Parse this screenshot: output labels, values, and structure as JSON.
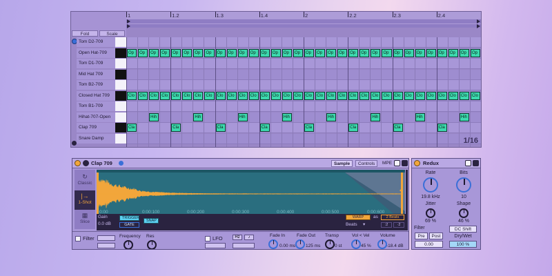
{
  "midi_editor": {
    "ruler": [
      "1",
      "1.2",
      "1.3",
      "1.4",
      "2",
      "2.2",
      "2.3",
      "2.4"
    ],
    "fold_label": "Fold",
    "scale_label": "Scale",
    "zoom": "1/16",
    "rows": [
      {
        "name": "Tom D2-709",
        "key": "w",
        "note": "",
        "steps": []
      },
      {
        "name": "Open Hat-709",
        "key": "b",
        "note": "Op",
        "steps": [
          0,
          1,
          2,
          3,
          4,
          5,
          6,
          7,
          8,
          9,
          10,
          11,
          12,
          13,
          14,
          15,
          16,
          17,
          18,
          19,
          20,
          21,
          22,
          23,
          24,
          25,
          26,
          27,
          28,
          29,
          30,
          31
        ]
      },
      {
        "name": "Tom D1-709",
        "key": "w",
        "note": "",
        "steps": []
      },
      {
        "name": "Mid Hat 709",
        "key": "b",
        "note": "",
        "steps": []
      },
      {
        "name": "Tom B2-709",
        "key": "w",
        "note": "",
        "steps": []
      },
      {
        "name": "Closed Hat 709",
        "key": "b",
        "note": "Clo",
        "steps": [
          0,
          1,
          2,
          3,
          4,
          5,
          6,
          7,
          8,
          9,
          10,
          11,
          12,
          13,
          14,
          15,
          16,
          17,
          18,
          19,
          20,
          21,
          22,
          23,
          24,
          25,
          26,
          27,
          28,
          29,
          30,
          31
        ]
      },
      {
        "name": "Tom B1-709",
        "key": "w",
        "note": "",
        "steps": []
      },
      {
        "name": "Hihat-707-Open",
        "key": "w",
        "note": "Hih",
        "steps": [
          2,
          6,
          10,
          14,
          18,
          22,
          26,
          30
        ]
      },
      {
        "name": "Clap 709",
        "key": "b",
        "note": "Cla",
        "steps": [
          0,
          4,
          8,
          12,
          16,
          20,
          24,
          28
        ]
      },
      {
        "name": "Snare Damp",
        "key": "w",
        "note": "",
        "steps": []
      }
    ]
  },
  "simpler": {
    "title": "Clap 709",
    "tabs": [
      "Sample",
      "Controls",
      "MPE"
    ],
    "modes": [
      {
        "label": "Classic",
        "glyph": "↻"
      },
      {
        "label": "1-Shot",
        "glyph": "|→"
      },
      {
        "label": "Slice",
        "glyph": "▦"
      }
    ],
    "time_labels": [
      "0:00",
      "0:00:100",
      "0:00:200",
      "0:00:300",
      "0:00:400",
      "0:00:500",
      "0:00:600"
    ],
    "gain_label": "Gain",
    "gain_value": "0.0 dB",
    "trigger": "TRIGGER",
    "gate": "GATE",
    "snap": "SNAP",
    "warp": "WARP",
    "as_label": "as",
    "beats_value": "2 Beats",
    "beats_label": "Beats",
    "div2": ":2",
    "mul2": "·2",
    "filter_label": "Filter",
    "frequency_label": "Frequency",
    "res_label": "Res",
    "lfo_label": "LFO",
    "hz_label": "Hz",
    "note_label": "♪",
    "fade_in_label": "Fade In",
    "fade_in_value": "0.00 ms",
    "fade_out_label": "Fade Out",
    "fade_out_value": "125 ms",
    "transp_label": "Transp",
    "transp_value": "0 st",
    "vol_vel_label": "Vol < Vel",
    "vol_vel_value": "45 %",
    "volume_label": "Volume",
    "volume_value": "-18.4 dB",
    "colors": {
      "accent": "#f2a63b",
      "waveform": "#f2a63b",
      "wave_bg": "#2a6e7f"
    }
  },
  "redux": {
    "title": "Redux",
    "rate_label": "Rate",
    "rate_value": "19.8 kHz",
    "bits_label": "Bits",
    "bits_value": "10",
    "jitter_label": "Jitter",
    "jitter_value": "69 %",
    "shape_label": "Shape",
    "shape_value": "46 %",
    "filter_label": "Filter",
    "pre_label": "Pre",
    "post_label": "Post",
    "filter_value": "0.00",
    "dc_shift_label": "DC Shift",
    "dry_wet_label": "Dry/Wet",
    "dry_wet_value": "100 %"
  }
}
